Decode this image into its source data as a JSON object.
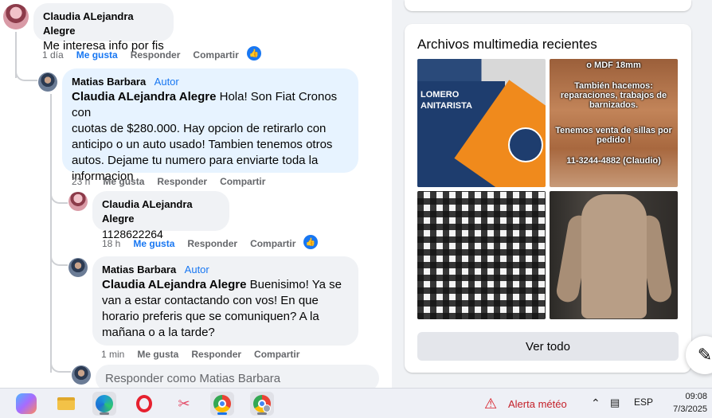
{
  "comments": {
    "c1": {
      "author": "Claudia ALejandra Alegre",
      "text": "Me interesa info por fis",
      "time": "1 día",
      "like": "Me gusta",
      "reply": "Responder",
      "share": "Compartir"
    },
    "r1": {
      "author": "Matias Barbara",
      "author_badge": "Autor",
      "mention": "Claudia ALejandra Alegre",
      "lines": [
        " Hola! Son Fiat Cronos con",
        "cuotas de $280.000. Hay opcion de retirarlo con",
        "anticipo o un auto usado! Tambien tenemos otros",
        "autos. Dejame tu numero para enviarte toda la",
        "informacion"
      ],
      "time": "23 h",
      "like": "Me gusta",
      "reply": "Responder",
      "share": "Compartir"
    },
    "r2": {
      "author": "Claudia ALejandra Alegre",
      "text": "1128622264",
      "time": "18 h",
      "like": "Me gusta",
      "reply": "Responder",
      "share": "Compartir"
    },
    "r3": {
      "author": "Matias Barbara",
      "author_badge": "Autor",
      "mention": "Claudia ALejandra Alegre",
      "lines": [
        " Buenisimo! Ya se",
        "van a estar contactando con vos! En que",
        "horario preferis que se comuniquen? A la",
        "mañana o a la tarde?"
      ],
      "time": "1 min",
      "like": "Me gusta",
      "reply": "Responder",
      "share": "Compartir"
    },
    "reply_placeholder": "Responder como Matias Barbara"
  },
  "media": {
    "title": "Archivos multimedia recientes",
    "thumb1_text": [
      "LOMERO",
      "ANITARISTA"
    ],
    "thumb2_text": [
      "o MDF 18mm",
      "También hacemos:",
      "reparaciones, trabajos de",
      "barnizados.",
      "Tenemos venta de sillas por",
      "pedido !",
      "11-3244-4882 (Claudio)"
    ],
    "see_all": "Ver todo"
  },
  "taskbar": {
    "apps": [
      "copilot-icon",
      "file-explorer-icon",
      "edge-icon",
      "opera-icon",
      "snipping-tool-icon",
      "chrome-icon",
      "chrome-profile-icon"
    ],
    "alert": "Alerta météo",
    "language": "ESP",
    "time": "09:08",
    "date": "7/3/2025"
  },
  "colors": {
    "accent": "#1877f2",
    "bubble": "#f0f2f5",
    "alert": "#c4212a"
  }
}
